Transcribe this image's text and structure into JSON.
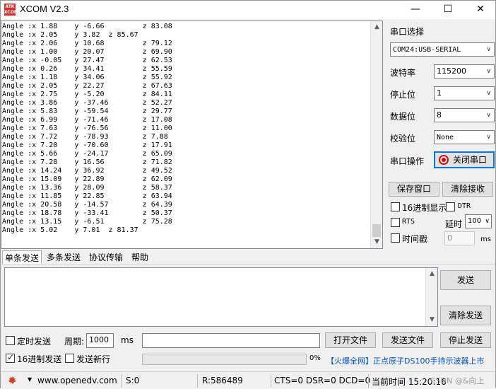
{
  "window": {
    "title": "XCOM V2.3",
    "logo_text": "ATK XCOM",
    "minimize": "—",
    "maximize": "☐",
    "close": "✕"
  },
  "receive": {
    "lines": [
      "Angle :x 1.88    y -6.66         z 83.08",
      "Angle :x 2.05    y 3.82  z 85.67",
      "Angle :x 2.06    y 10.68         z 79.12",
      "Angle :x 1.00    y 20.07         z 69.90",
      "Angle :x -0.05   y 27.47         z 62.53",
      "Angle :x 0.26    y 34.41         z 55.59",
      "Angle :x 1.18    y 34.06         z 55.92",
      "Angle :x 2.05    y 22.27         z 67.63",
      "Angle :x 2.75    y -5.20         z 84.11",
      "Angle :x 3.86    y -37.46        z 52.27",
      "Angle :x 5.83    y -59.54        z 29.77",
      "Angle :x 6.99    y -71.46        z 17.08",
      "Angle :x 7.63    y -76.56        z 11.00",
      "Angle :x 7.72    y -78.93        z 7.88",
      "Angle :x 7.20    y -70.60        z 17.91",
      "Angle :x 5.66    y -24.17        z 65.09",
      "Angle :x 7.28    y 16.56         z 71.82",
      "Angle :x 14.24   y 36.92         z 49.52",
      "Angle :x 15.09   y 22.89         z 62.09",
      "Angle :x 13.36   y 28.09         z 58.37",
      "Angle :x 11.85   y 22.85         z 63.94",
      "Angle :x 20.58   y -14.57        z 64.39",
      "Angle :x 18.78   y -33.41        z 50.37",
      "Angle :x 13.15   y -6.51         z 75.28",
      "Angle :x 5.02    y 7.01  z 81.37"
    ]
  },
  "serial": {
    "port_label": "串口选择",
    "port_value": "COM24:USB-SERIAL",
    "baud_label": "波特率",
    "baud_value": "115200",
    "stop_label": "停止位",
    "stop_value": "1",
    "data_label": "数据位",
    "data_value": "8",
    "parity_label": "校验位",
    "parity_value": "None",
    "op_label": "串口操作",
    "close_port_button": "关闭串口",
    "save_window_button": "保存窗口",
    "clear_recv_button": "清除接收",
    "hex_display_label": "16进制显示",
    "dtr_label": "DTR",
    "rts_label": "RTS",
    "delay_label": "延时",
    "delay_value": "100",
    "timestamp_label": "时间戳",
    "timestamp_value": "0",
    "ms_label": "ms",
    "status_color": "#e00000"
  },
  "tabs": [
    "单条发送",
    "多条发送",
    "协议传输",
    "帮助"
  ],
  "send": {
    "send_button": "发送",
    "clear_send_button": "清除发送",
    "timed_send_label": "定时发送",
    "period_label": "周期:",
    "period_value": "1000",
    "ms_label": "ms",
    "open_file_button": "打开文件",
    "send_file_button": "发送文件",
    "stop_send_button": "停止发送",
    "hex_send_label": "16进制发送",
    "newline_label": "发送新行",
    "progress_text": "0%",
    "ad_text": "【火爆全网】正点原子DS100手持示波器上市",
    "ad_color": "#0050c8"
  },
  "statusbar": {
    "url": "www.openedv.com",
    "sent": "S:0",
    "received": "R:586489",
    "signals": "CTS=0 DSR=0 DCD=0",
    "time": "当前时间 15:20:16",
    "watermark": "CSDN @&向上"
  }
}
